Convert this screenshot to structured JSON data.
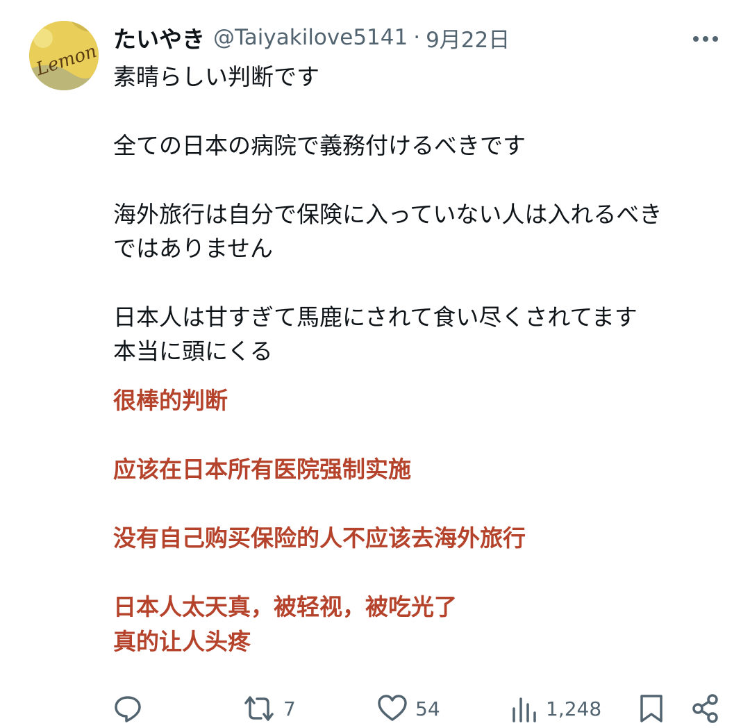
{
  "user": {
    "display_name": "たいやき",
    "handle": "@Taiyakilove5141",
    "separator": "·",
    "date": "9月22日",
    "avatar_text": "Lemon"
  },
  "tweet": {
    "lines": [
      "素晴らしい判断です",
      "全ての日本の病院で義務付けるべきです",
      "海外旅行は自分で保険に入っていない人は入れるべき",
      "ではありません",
      "日本人は甘すぎて馬鹿にされて食い尽くされてます",
      "本当に頭にくる"
    ]
  },
  "translation": {
    "lines": [
      "很棒的判断",
      "应该在日本所有医院强制实施",
      "没有自己购买保险的人不应该去海外旅行",
      "日本人太天真，被轻视，被吃光了",
      "真的让人头疼"
    ],
    "color": "#b5432b"
  },
  "actions": {
    "reply": {
      "icon": "reply-icon",
      "count": ""
    },
    "retweet": {
      "icon": "retweet-icon",
      "count": "7"
    },
    "like": {
      "icon": "heart-icon",
      "count": "54"
    },
    "views": {
      "icon": "views-icon",
      "count": "1,248"
    },
    "bookmark": {
      "icon": "bookmark-icon",
      "count": ""
    },
    "share": {
      "icon": "share-icon",
      "count": ""
    }
  },
  "colors": {
    "text_primary": "#0f1419",
    "text_secondary": "#536471",
    "translation": "#b5432b"
  }
}
